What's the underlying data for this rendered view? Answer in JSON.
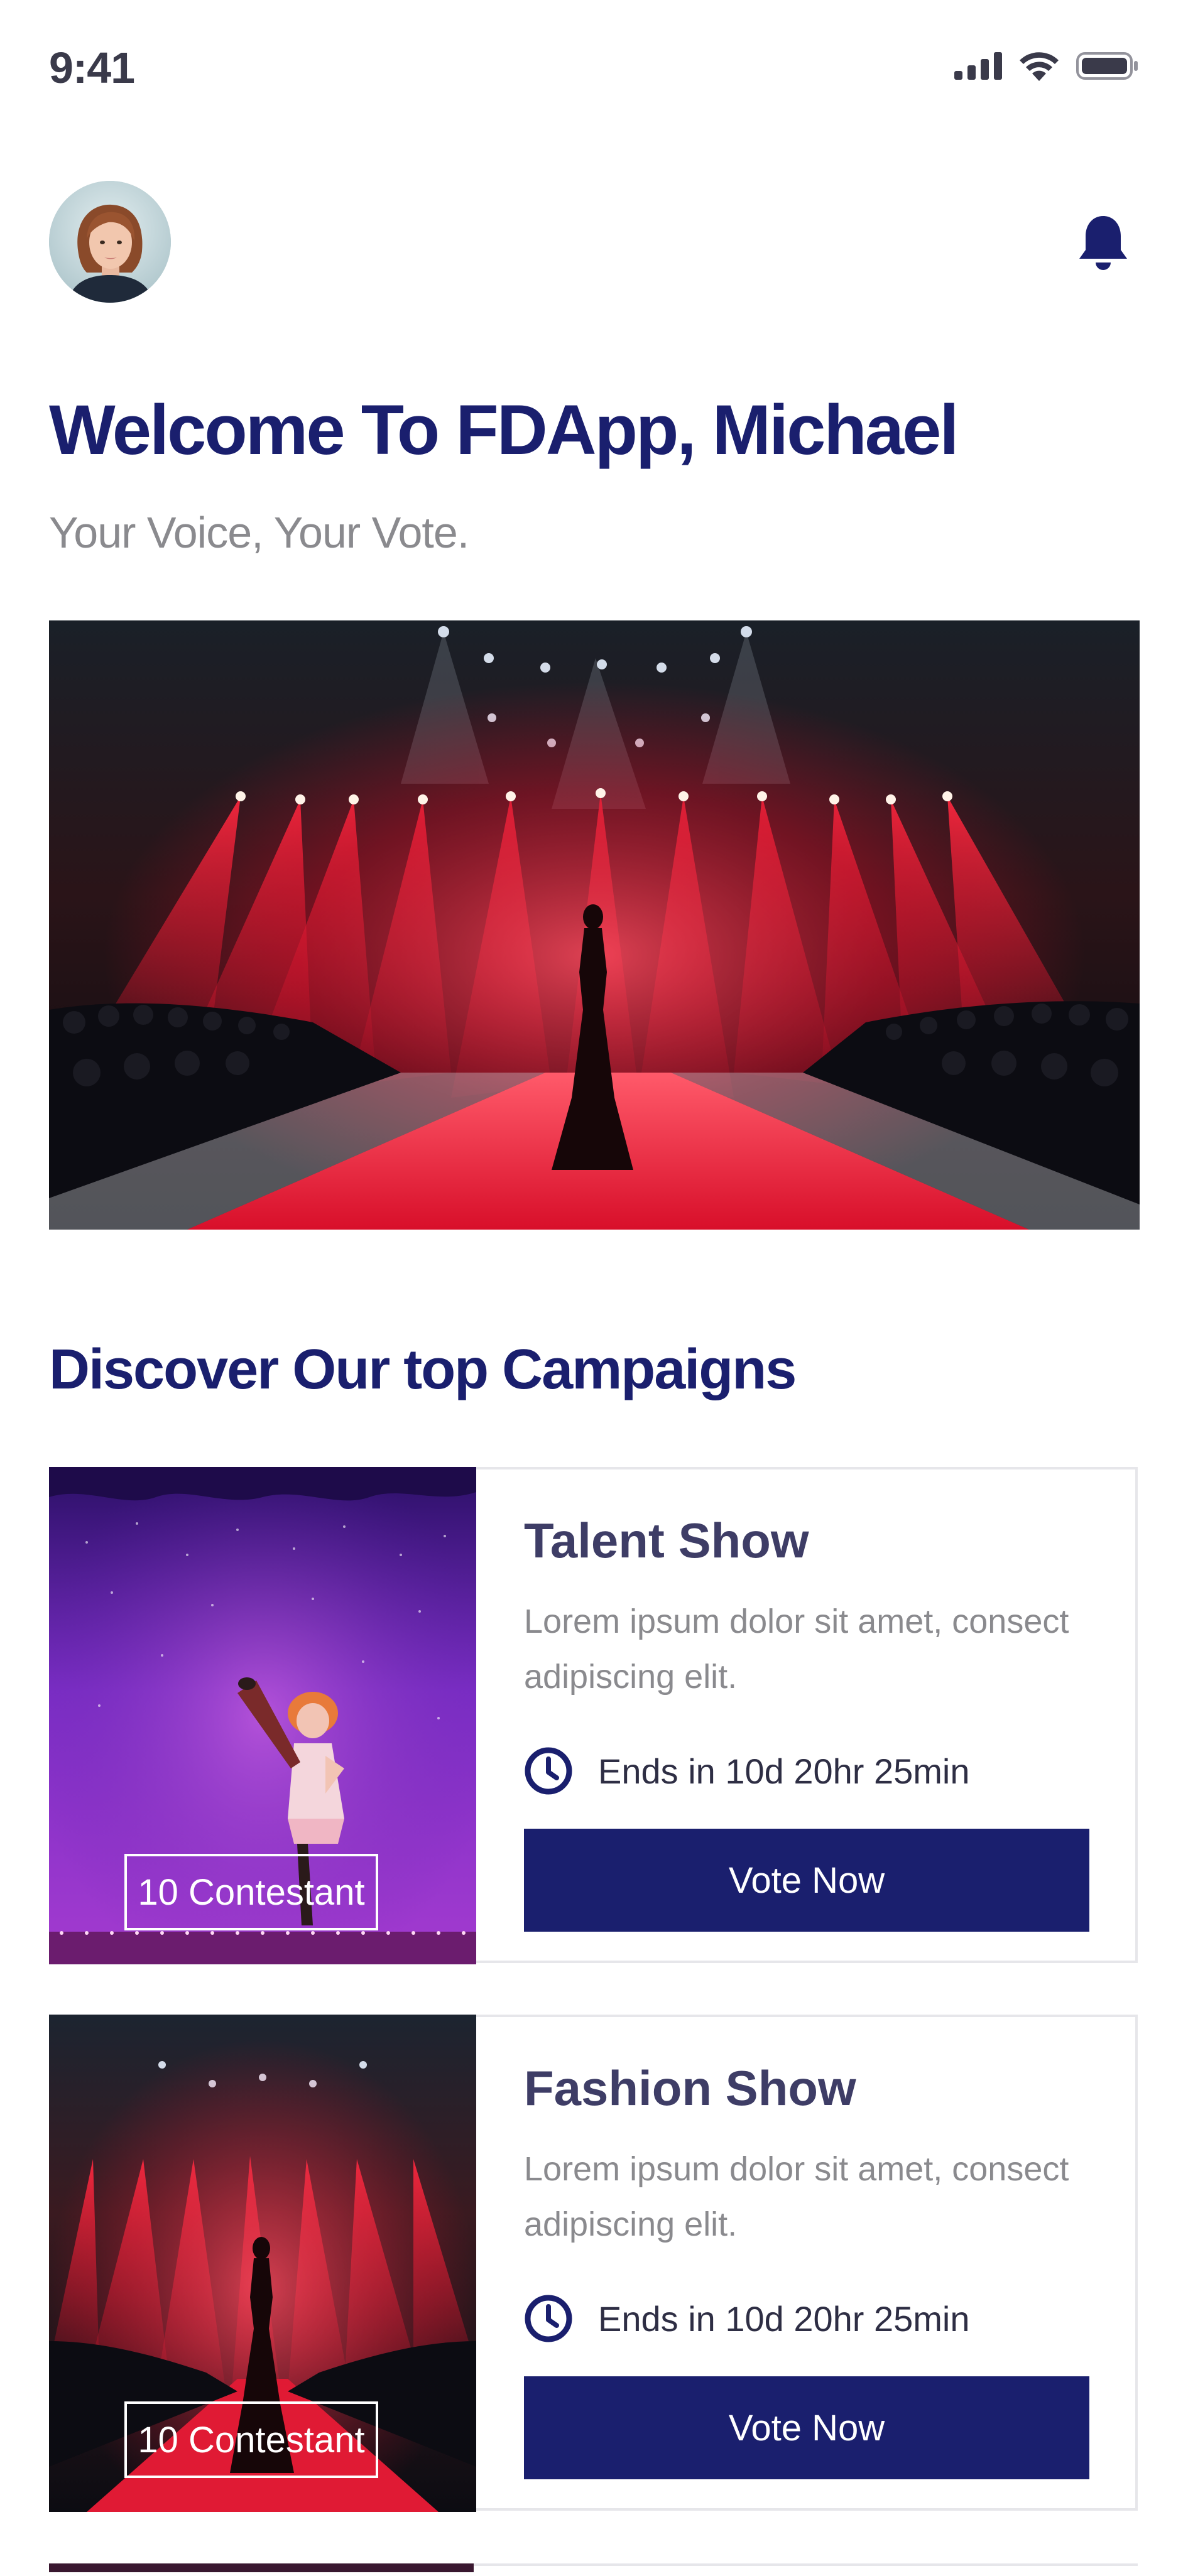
{
  "status_bar": {
    "time": "9:41",
    "icons": [
      "cellular-signal-icon",
      "wifi-icon",
      "battery-icon"
    ]
  },
  "header": {
    "avatar_icon": "avatar",
    "notification_icon": "bell-icon"
  },
  "welcome": {
    "title": "Welcome To FDApp, Michael",
    "subtitle": "Your Voice, Your Vote."
  },
  "hero": {
    "image": "runway-stage-hero-image"
  },
  "campaigns": {
    "section_title": "Discover Our top Campaigns",
    "items": [
      {
        "title": "Talent Show",
        "description": "Lorem ipsum dolor sit amet, consect adipiscing elit.",
        "ends": "Ends in 10d 20hr 25min",
        "contestants": "10 Contestant",
        "button": "Vote Now"
      },
      {
        "title": "Fashion Show",
        "description": "Lorem ipsum dolor sit amet, consect adipiscing elit.",
        "ends": "Ends in 10d 20hr 25min",
        "contestants": "10 Contestant",
        "button": "Vote Now"
      }
    ]
  },
  "colors": {
    "primary": "#1a1f6e",
    "muted_text": "#8a8a8e",
    "card_title": "#3e3d66",
    "card_border": "#e6e6ea",
    "stage_red": "#e0112b"
  }
}
